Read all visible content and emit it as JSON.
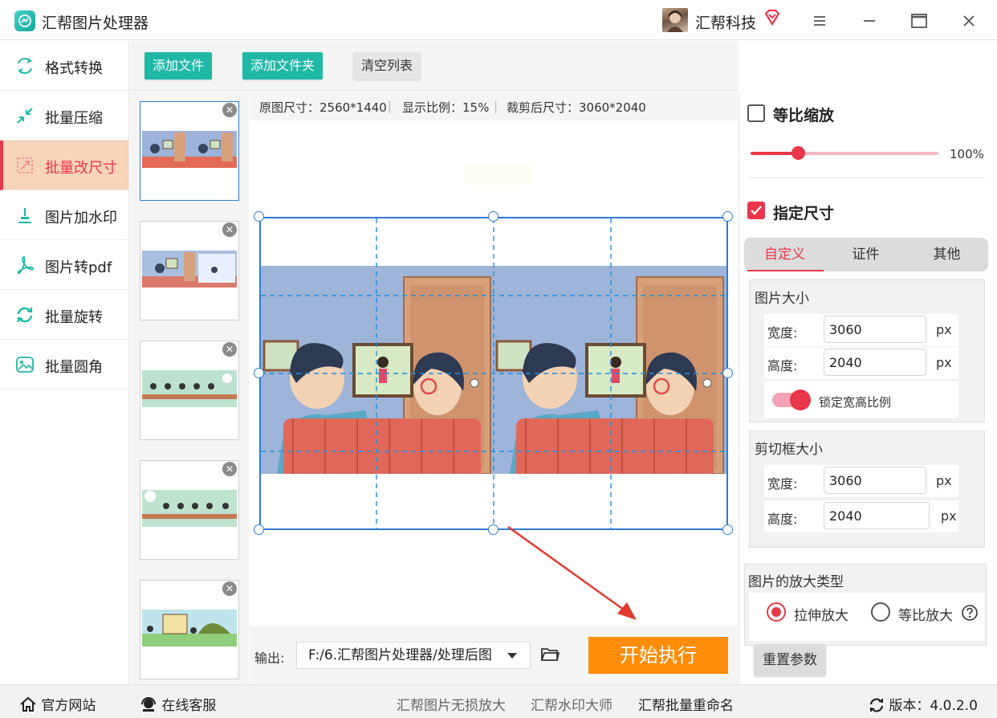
{
  "app": {
    "title": "汇帮图片处理器",
    "user_name": "汇帮科技",
    "accent_color": "#e9374a",
    "teal_color": "#1fb8a5",
    "orange_color": "#ff8d0a"
  },
  "sidebar": {
    "items": [
      {
        "label": "格式转换",
        "icon": "format-convert-icon"
      },
      {
        "label": "批量压缩",
        "icon": "compress-icon"
      },
      {
        "label": "批量改尺寸",
        "icon": "resize-icon",
        "active": true
      },
      {
        "label": "图片加水印",
        "icon": "watermark-icon"
      },
      {
        "label": "图片转pdf",
        "icon": "pdf-icon"
      },
      {
        "label": "批量旋转",
        "icon": "rotate-icon"
      },
      {
        "label": "批量圆角",
        "icon": "round-corner-icon"
      }
    ]
  },
  "toolbar": {
    "add_file": "添加文件",
    "add_folder": "添加文件夹",
    "clear_list": "清空列表"
  },
  "canvas": {
    "original_size": "原图尺寸：2560*1440",
    "display_ratio": "显示比例：15%",
    "cropped_size": "裁剪后尺寸：3060*2040"
  },
  "output": {
    "label": "输出:",
    "path": "F:/6.汇帮图片处理器/处理后图",
    "start_button": "开始执行"
  },
  "right_panel": {
    "proportional_scale": {
      "label": "等比缩放",
      "checked": false,
      "value_label": "100%",
      "level": 0.25
    },
    "specify_size": {
      "label": "指定尺寸",
      "checked": true
    },
    "tabs": [
      "自定义",
      "证件",
      "其他"
    ],
    "active_tab": 0,
    "image_size": {
      "title": "图片大小",
      "width_label": "宽度:",
      "width_value": "3060",
      "height_label": "高度:",
      "height_value": "2040",
      "unit": "px",
      "lock_label": "锁定宽高比例",
      "lock_on": true
    },
    "crop_size": {
      "title": "剪切框大小",
      "width_label": "宽度:",
      "width_value": "3060",
      "height_label": "高度:",
      "height_value": "2040",
      "unit": "px"
    },
    "enlarge_type": {
      "title": "图片的放大类型",
      "options": [
        "拉伸放大",
        "等比放大"
      ],
      "selected": 0
    },
    "reset_button": "重置参数"
  },
  "footer": {
    "website": "官方网站",
    "service": "在线客服",
    "link1": "汇帮图片无损放大",
    "link2": "汇帮水印大师",
    "link3": "汇帮批量重命名",
    "version": "版本：4.0.2.0"
  }
}
